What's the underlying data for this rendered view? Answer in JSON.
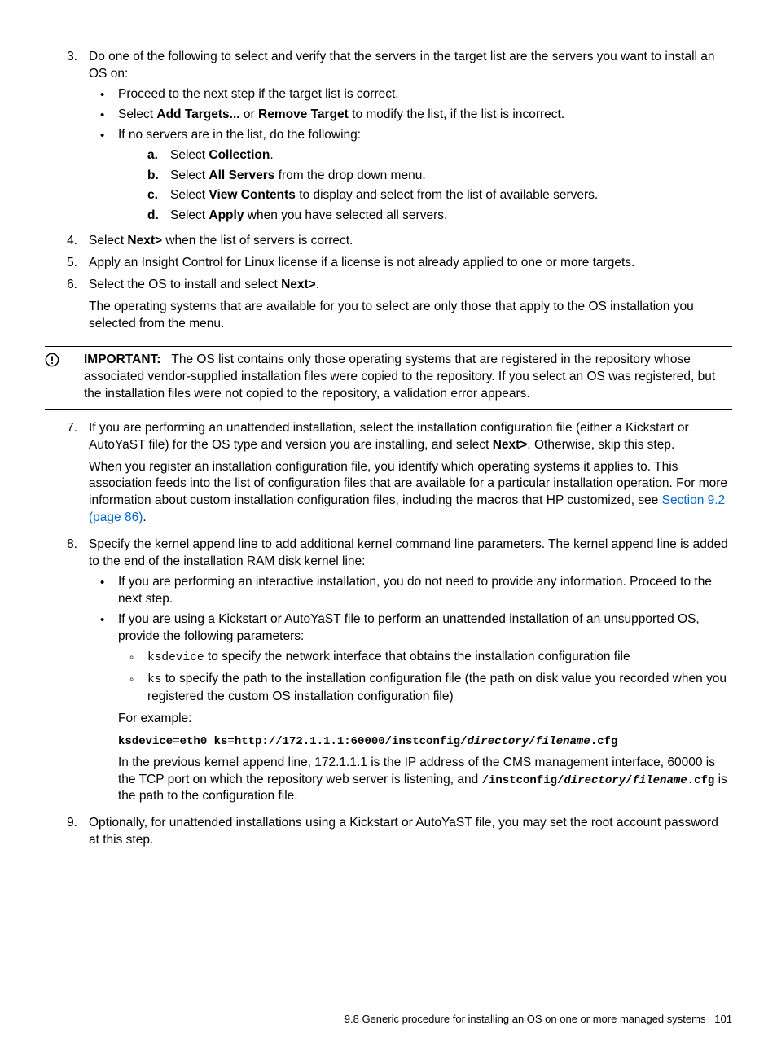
{
  "steps": {
    "s3": {
      "num": "3.",
      "text_a": "Do one of the following to select and verify that the servers in the target list are the servers you want to install an OS on:",
      "b1": "Proceed to the next step if the target list is correct.",
      "b2_a": "Select ",
      "b2_bold1": "Add Targets...",
      "b2_mid": " or ",
      "b2_bold2": "Remove Target",
      "b2_end": " to modify the list, if the list is incorrect.",
      "b3": "If no servers are in the list, do the following:",
      "a_label": "a.",
      "a_text_a": "Select ",
      "a_bold": "Collection",
      "a_text_b": ".",
      "b_label": "b.",
      "b_text_a": "Select ",
      "b_bold": "All Servers",
      "b_text_b": " from the drop down menu.",
      "c_label": "c.",
      "c_text_a": "Select ",
      "c_bold": "View Contents",
      "c_text_b": " to display and select from the list of available servers.",
      "d_label": "d.",
      "d_text_a": "Select ",
      "d_bold": "Apply",
      "d_text_b": " when you have selected all servers."
    },
    "s4": {
      "num": "4.",
      "text_a": "Select ",
      "bold": "Next>",
      "text_b": " when the list of servers is correct."
    },
    "s5": {
      "num": "5.",
      "text": "Apply an Insight Control for Linux license if a license is not already applied to one or more targets."
    },
    "s6": {
      "num": "6.",
      "text_a": "Select the OS to install and select ",
      "bold": "Next>",
      "text_b": ".",
      "para": "The operating systems that are available for you to select are only those that apply to the OS installation you selected from the menu."
    },
    "important": {
      "label": "IMPORTANT:",
      "text": "The OS list contains only those operating systems that are registered in the repository whose associated vendor-supplied installation files were copied to the repository. If you select an OS was registered, but the installation files were not copied to the repository, a validation error appears."
    },
    "s7": {
      "num": "7.",
      "text_a": "If you are performing an unattended installation, select the installation configuration file (either a Kickstart or AutoYaST file) for the OS type and version you are installing, and select ",
      "bold": "Next>",
      "text_b": ". Otherwise, skip this step.",
      "para_a": "When you register an installation configuration file, you identify which operating systems it applies to. This association feeds into the list of configuration files that are available for a particular installation operation. For more information about custom installation configuration files, including the macros that HP customized, see ",
      "link": "Section 9.2 (page 86)",
      "para_b": "."
    },
    "s8": {
      "num": "8.",
      "text": "Specify the kernel append line to add additional kernel command line parameters. The kernel append line is added to the end of the installation RAM disk kernel line:",
      "b1": "If you are performing an interactive installation, you do not need to provide any information. Proceed to the next step.",
      "b2": "If you are using a Kickstart or AutoYaST file to perform an unattended installation of an unsupported OS, provide the following parameters:",
      "c1_code": "ksdevice",
      "c1_text": " to specify the network interface that obtains the installation configuration file",
      "c2_code": "ks",
      "c2_text": " to specify the path to the installation configuration file (the path on disk value you recorded when you registered the custom OS installation configuration file)",
      "for_example": "For example:",
      "example_a": "ksdevice=eth0 ks=http://172.1.1.1:60000/instconfig/",
      "example_dir": "directory",
      "example_slash": "/",
      "example_file": "filename",
      "example_ext": ".cfg",
      "expl_a": "In the previous kernel append line, 172.1.1.1 is the IP address of the CMS management interface, 60000 is the TCP port on which the repository web server is listening, and ",
      "expl_path_a": "/instconfig/",
      "expl_dir": "directory",
      "expl_slash": "/",
      "expl_file": "filename",
      "expl_ext": ".cfg",
      "expl_b": " is the path to the configuration file."
    },
    "s9": {
      "num": "9.",
      "text": "Optionally, for unattended installations using a Kickstart or AutoYaST file, you may set the root account password at this step."
    }
  },
  "footer": {
    "text": "9.8 Generic procedure for installing an OS on one or more managed systems",
    "page": "101"
  }
}
